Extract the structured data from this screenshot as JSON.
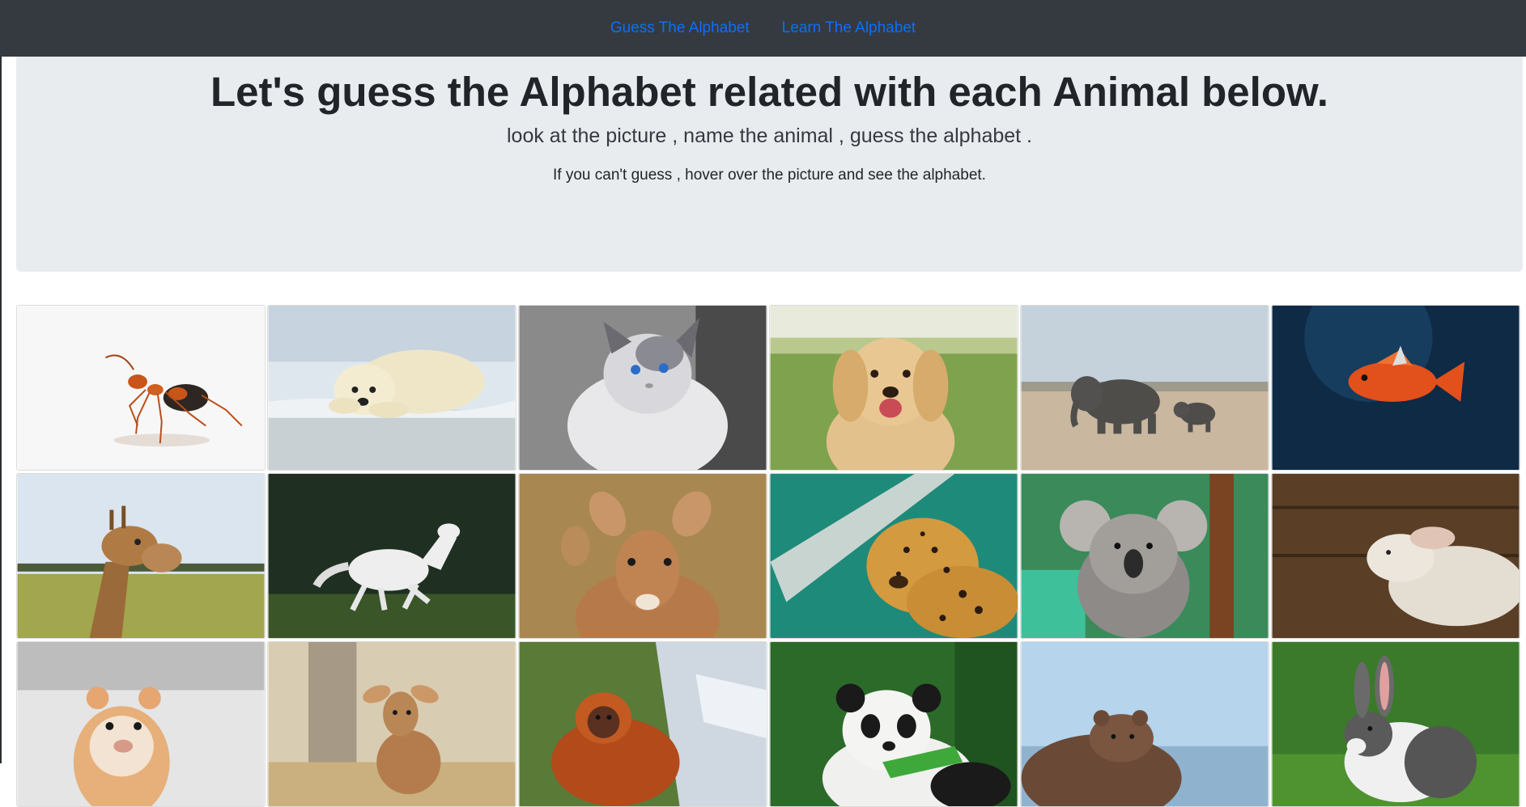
{
  "nav": {
    "links": [
      "Guess The Alphabet",
      "Learn The Alphabet"
    ]
  },
  "jumbotron": {
    "title": "Let's guess the Alphabet related with each Animal below.",
    "subtitle": "look at the picture , name the animal , guess the alphabet .",
    "hint": "If you can't guess , hover over the picture and see the alphabet."
  },
  "colors": {
    "navbar": "#343a40",
    "link": "#0d6efd",
    "jumbotron": "#e9ecef"
  },
  "animals": [
    "ant",
    "bear",
    "cat",
    "dog",
    "elephant",
    "fish",
    "giraffe",
    "horse",
    "impala",
    "jaguar",
    "koala",
    "lamb",
    "hamster",
    "deer",
    "orangutan",
    "panda",
    "quokka",
    "rabbit"
  ]
}
